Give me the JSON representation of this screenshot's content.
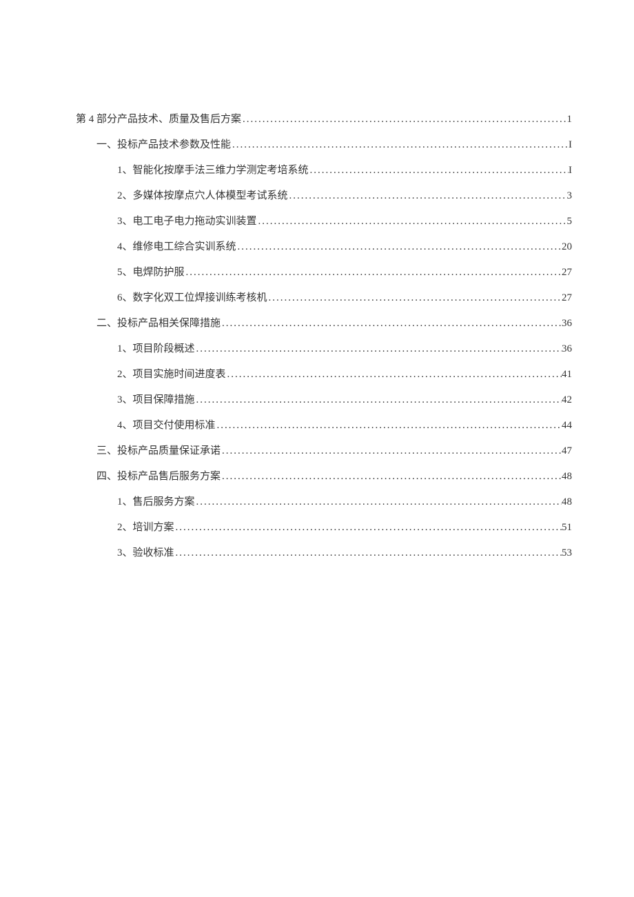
{
  "toc": [
    {
      "level": 1,
      "label": "第 4 部分产品技术、质量及售后方案",
      "page": "1"
    },
    {
      "level": 2,
      "label": "一、投标产品技术参数及性能",
      "page": "I"
    },
    {
      "level": 3,
      "label": "1、智能化按摩手法三维力学测定考培系统 ",
      "page": "I"
    },
    {
      "level": 3,
      "label": "2、多媒体按摩点穴人体模型考试系统 ",
      "page": "3"
    },
    {
      "level": 3,
      "label": "3、电工电子电力拖动实训装置 ",
      "page": "5"
    },
    {
      "level": 3,
      "label": "4、维修电工综合实训系统 ",
      "page": "20"
    },
    {
      "level": 3,
      "label": "5、电焊防护服 ",
      "page": "27"
    },
    {
      "level": 3,
      "label": "6、数字化双工位焊接训练考核机 ",
      "page": "27"
    },
    {
      "level": 2,
      "label": "二、投标产品相关保障措施",
      "page": "36"
    },
    {
      "level": 3,
      "label": "1、项目阶段概述 ",
      "page": "36"
    },
    {
      "level": 3,
      "label": "2、项目实施时间进度表 ",
      "page": "41"
    },
    {
      "level": 3,
      "label": "3、项目保障措施 ",
      "page": "42"
    },
    {
      "level": 3,
      "label": "4、项目交付使用标准 ",
      "page": "44"
    },
    {
      "level": 2,
      "label": "三、投标产品质量保证承诺",
      "page": "47"
    },
    {
      "level": 2,
      "label": "四、投标产品售后服务方案",
      "page": "48"
    },
    {
      "level": 3,
      "label": "1、售后服务方案 ",
      "page": "48"
    },
    {
      "level": 3,
      "label": "2、培训方案 ",
      "page": "51"
    },
    {
      "level": 3,
      "label": "3、验收标准 ",
      "page": "53"
    }
  ]
}
